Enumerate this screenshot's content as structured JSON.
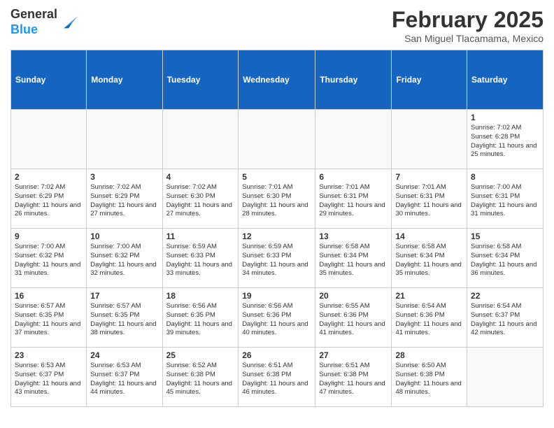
{
  "header": {
    "logo_general": "General",
    "logo_blue": "Blue",
    "month_title": "February 2025",
    "location": "San Miguel Tlacamama, Mexico"
  },
  "weekdays": [
    "Sunday",
    "Monday",
    "Tuesday",
    "Wednesday",
    "Thursday",
    "Friday",
    "Saturday"
  ],
  "weeks": [
    [
      {
        "day": "",
        "info": ""
      },
      {
        "day": "",
        "info": ""
      },
      {
        "day": "",
        "info": ""
      },
      {
        "day": "",
        "info": ""
      },
      {
        "day": "",
        "info": ""
      },
      {
        "day": "",
        "info": ""
      },
      {
        "day": "1",
        "info": "Sunrise: 7:02 AM\nSunset: 6:28 PM\nDaylight: 11 hours and 25 minutes."
      }
    ],
    [
      {
        "day": "2",
        "info": "Sunrise: 7:02 AM\nSunset: 6:29 PM\nDaylight: 11 hours and 26 minutes."
      },
      {
        "day": "3",
        "info": "Sunrise: 7:02 AM\nSunset: 6:29 PM\nDaylight: 11 hours and 27 minutes."
      },
      {
        "day": "4",
        "info": "Sunrise: 7:02 AM\nSunset: 6:30 PM\nDaylight: 11 hours and 27 minutes."
      },
      {
        "day": "5",
        "info": "Sunrise: 7:01 AM\nSunset: 6:30 PM\nDaylight: 11 hours and 28 minutes."
      },
      {
        "day": "6",
        "info": "Sunrise: 7:01 AM\nSunset: 6:31 PM\nDaylight: 11 hours and 29 minutes."
      },
      {
        "day": "7",
        "info": "Sunrise: 7:01 AM\nSunset: 6:31 PM\nDaylight: 11 hours and 30 minutes."
      },
      {
        "day": "8",
        "info": "Sunrise: 7:00 AM\nSunset: 6:31 PM\nDaylight: 11 hours and 31 minutes."
      }
    ],
    [
      {
        "day": "9",
        "info": "Sunrise: 7:00 AM\nSunset: 6:32 PM\nDaylight: 11 hours and 31 minutes."
      },
      {
        "day": "10",
        "info": "Sunrise: 7:00 AM\nSunset: 6:32 PM\nDaylight: 11 hours and 32 minutes."
      },
      {
        "day": "11",
        "info": "Sunrise: 6:59 AM\nSunset: 6:33 PM\nDaylight: 11 hours and 33 minutes."
      },
      {
        "day": "12",
        "info": "Sunrise: 6:59 AM\nSunset: 6:33 PM\nDaylight: 11 hours and 34 minutes."
      },
      {
        "day": "13",
        "info": "Sunrise: 6:58 AM\nSunset: 6:34 PM\nDaylight: 11 hours and 35 minutes."
      },
      {
        "day": "14",
        "info": "Sunrise: 6:58 AM\nSunset: 6:34 PM\nDaylight: 11 hours and 35 minutes."
      },
      {
        "day": "15",
        "info": "Sunrise: 6:58 AM\nSunset: 6:34 PM\nDaylight: 11 hours and 36 minutes."
      }
    ],
    [
      {
        "day": "16",
        "info": "Sunrise: 6:57 AM\nSunset: 6:35 PM\nDaylight: 11 hours and 37 minutes."
      },
      {
        "day": "17",
        "info": "Sunrise: 6:57 AM\nSunset: 6:35 PM\nDaylight: 11 hours and 38 minutes."
      },
      {
        "day": "18",
        "info": "Sunrise: 6:56 AM\nSunset: 6:35 PM\nDaylight: 11 hours and 39 minutes."
      },
      {
        "day": "19",
        "info": "Sunrise: 6:56 AM\nSunset: 6:36 PM\nDaylight: 11 hours and 40 minutes."
      },
      {
        "day": "20",
        "info": "Sunrise: 6:55 AM\nSunset: 6:36 PM\nDaylight: 11 hours and 41 minutes."
      },
      {
        "day": "21",
        "info": "Sunrise: 6:54 AM\nSunset: 6:36 PM\nDaylight: 11 hours and 41 minutes."
      },
      {
        "day": "22",
        "info": "Sunrise: 6:54 AM\nSunset: 6:37 PM\nDaylight: 11 hours and 42 minutes."
      }
    ],
    [
      {
        "day": "23",
        "info": "Sunrise: 6:53 AM\nSunset: 6:37 PM\nDaylight: 11 hours and 43 minutes."
      },
      {
        "day": "24",
        "info": "Sunrise: 6:53 AM\nSunset: 6:37 PM\nDaylight: 11 hours and 44 minutes."
      },
      {
        "day": "25",
        "info": "Sunrise: 6:52 AM\nSunset: 6:38 PM\nDaylight: 11 hours and 45 minutes."
      },
      {
        "day": "26",
        "info": "Sunrise: 6:51 AM\nSunset: 6:38 PM\nDaylight: 11 hours and 46 minutes."
      },
      {
        "day": "27",
        "info": "Sunrise: 6:51 AM\nSunset: 6:38 PM\nDaylight: 11 hours and 47 minutes."
      },
      {
        "day": "28",
        "info": "Sunrise: 6:50 AM\nSunset: 6:38 PM\nDaylight: 11 hours and 48 minutes."
      },
      {
        "day": "",
        "info": ""
      }
    ]
  ]
}
